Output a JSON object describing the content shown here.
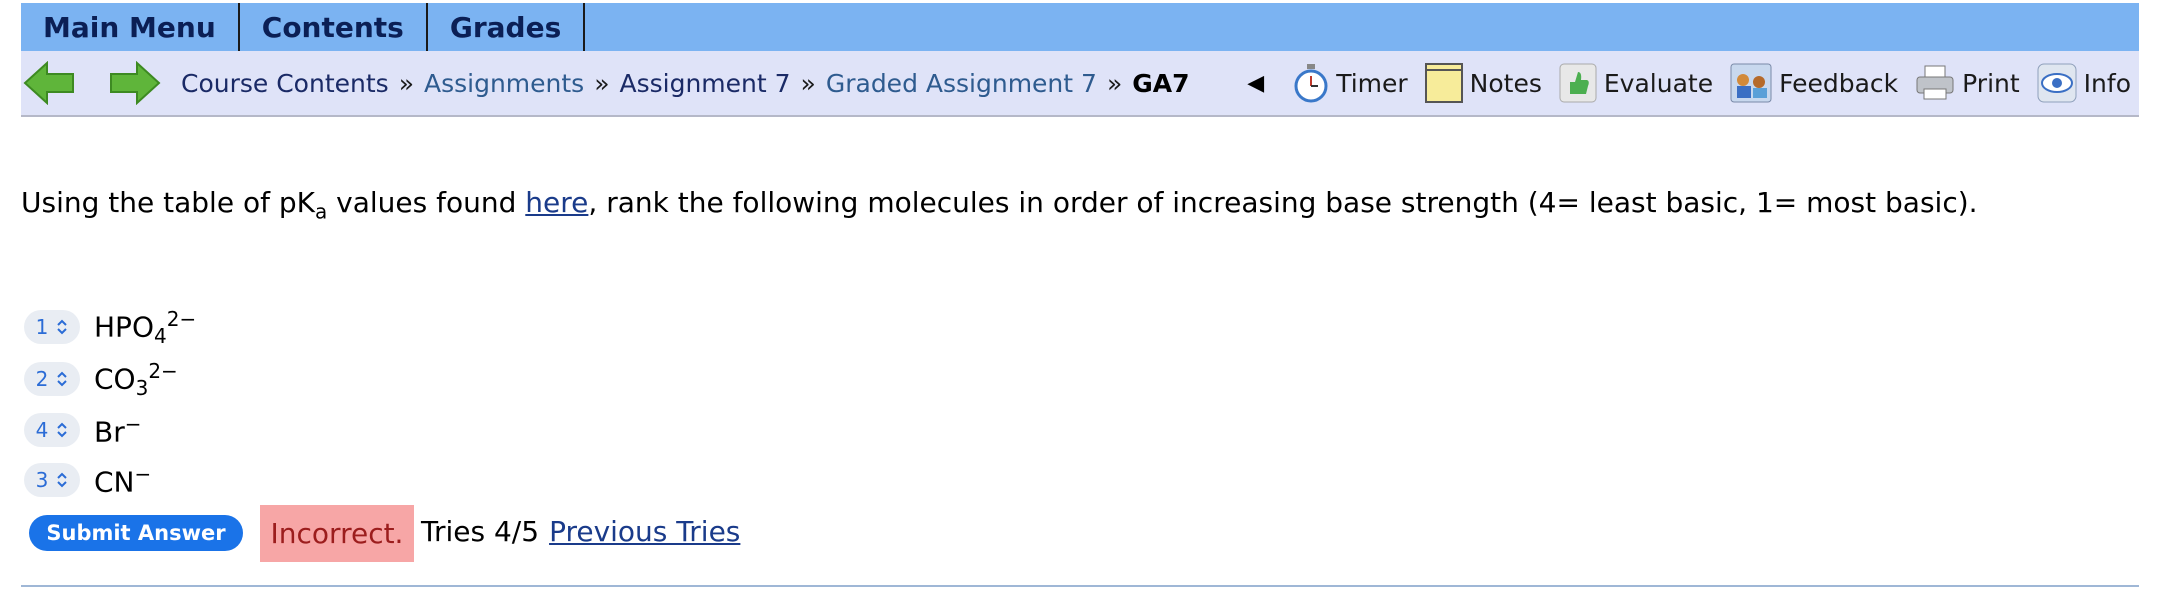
{
  "top_menu": {
    "items": [
      {
        "label": "Main Menu"
      },
      {
        "label": "Contents"
      },
      {
        "label": "Grades"
      }
    ]
  },
  "nav": {
    "back_icon": "left-arrow-icon",
    "forward_icon": "right-arrow-icon",
    "breadcrumbs": [
      {
        "label": "Course Contents"
      },
      {
        "label": "Assignments"
      },
      {
        "label": "Assignment 7"
      },
      {
        "label": "Graded Assignment 7"
      },
      {
        "label": "GA7"
      }
    ],
    "separator": "»",
    "collapse_glyph": "◀",
    "tools": [
      {
        "label": "Timer",
        "icon": "stopwatch-icon"
      },
      {
        "label": "Notes",
        "icon": "notepad-icon"
      },
      {
        "label": "Evaluate",
        "icon": "thumbs-up-icon"
      },
      {
        "label": "Feedback",
        "icon": "feedback-icon"
      },
      {
        "label": "Print",
        "icon": "printer-icon"
      },
      {
        "label": "Info",
        "icon": "info-eye-icon"
      }
    ]
  },
  "question": {
    "text_before": "Using the table of pK",
    "subscript": "a",
    "text_middle": " values found ",
    "link": "here",
    "text_after": ", rank the following molecules in order of increasing base strength (4= least basic, 1= most basic)."
  },
  "rankings": [
    {
      "rank": "1",
      "base": "HPO",
      "sub": "4",
      "sup": "2−"
    },
    {
      "rank": "2",
      "base": "CO",
      "sub": "3",
      "sup": "2−"
    },
    {
      "rank": "4",
      "base": "Br",
      "sub": "",
      "sup": "−"
    },
    {
      "rank": "3",
      "base": "CN",
      "sub": "",
      "sup": "−"
    }
  ],
  "actions": {
    "submit_label": "Submit Answer",
    "status": "Incorrect.",
    "tries": "Tries 4/5",
    "previous_tries": "Previous Tries"
  },
  "colors": {
    "top_bar": "#7bb3f2",
    "nav_bar": "#dfe3f8",
    "submit": "#1a73e8",
    "incorrect_bg": "#f7a6a6"
  }
}
